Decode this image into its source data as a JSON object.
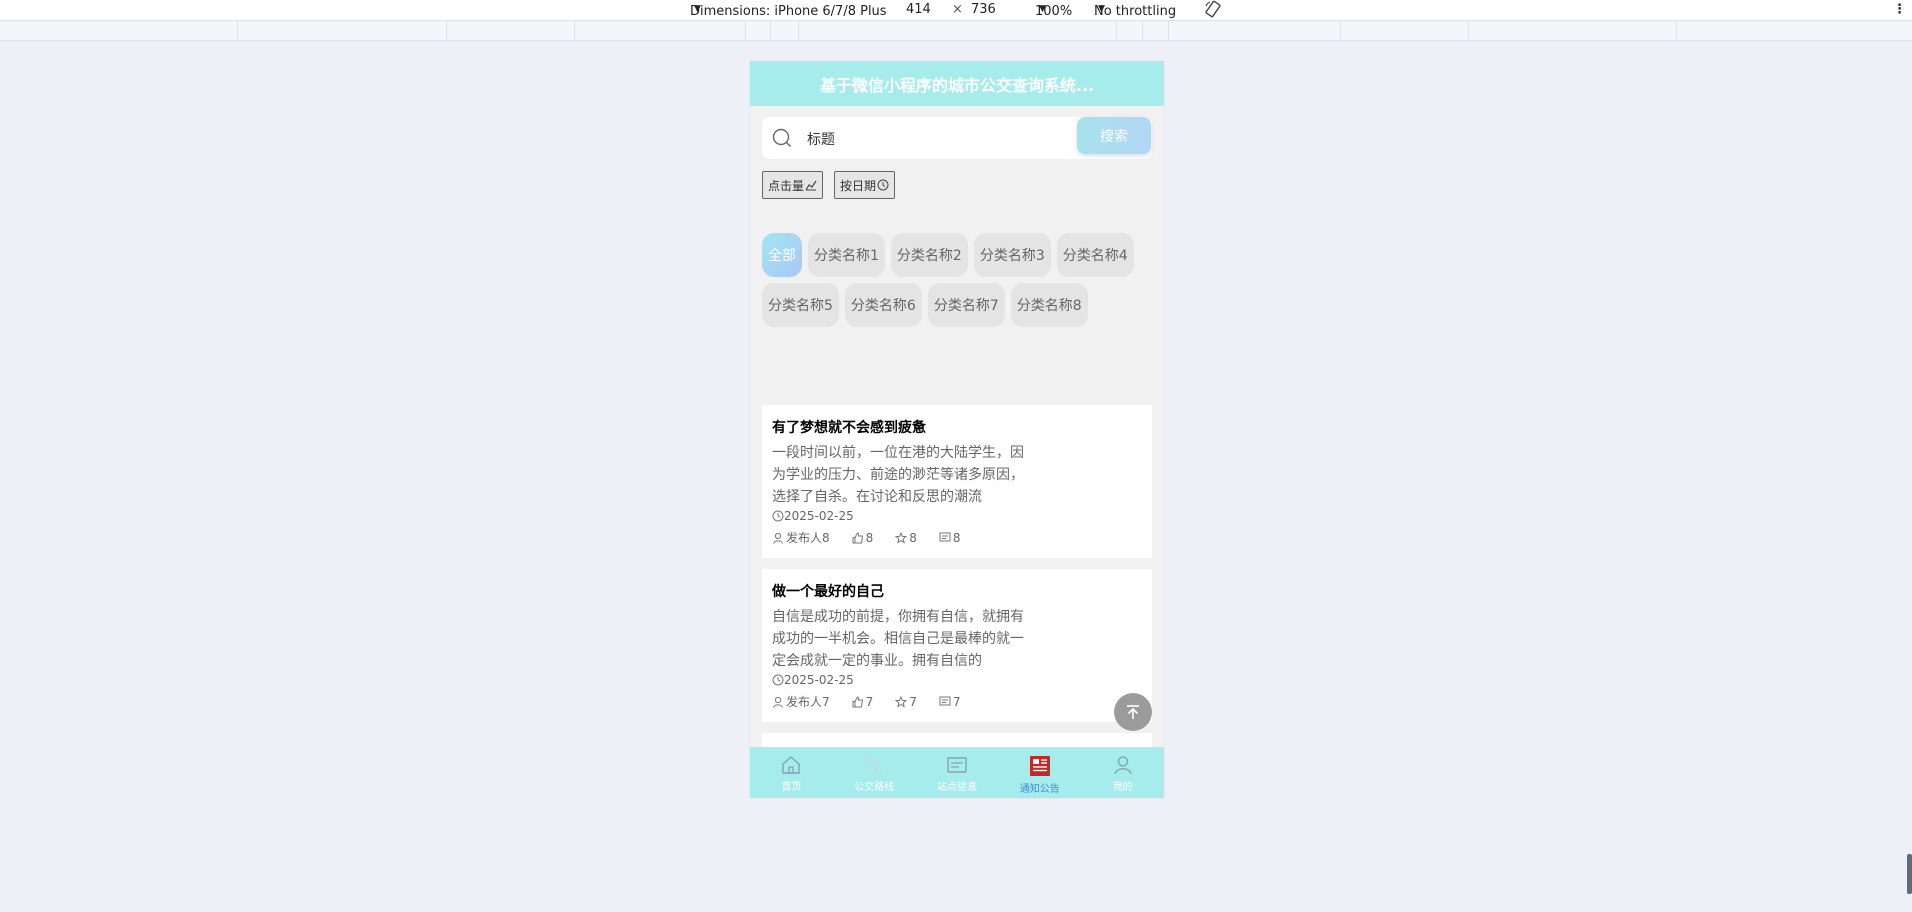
{
  "devtools": {
    "device": "Dimensions: iPhone 6/7/8 Plus",
    "width": "414",
    "times": "×",
    "height": "736",
    "zoom": "100%",
    "throttle": "No throttling",
    "more": "⋮"
  },
  "app": {
    "title": "基于微信小程序的城市公交查询系统..."
  },
  "search": {
    "value": "标题",
    "button": "搜索"
  },
  "sort": {
    "by_clicks": "点击量",
    "by_date": "按日期"
  },
  "categories": [
    "全部",
    "分类名称1",
    "分类名称2",
    "分类名称3",
    "分类名称4",
    "分类名称5",
    "分类名称6",
    "分类名称7",
    "分类名称8"
  ],
  "articles": [
    {
      "title": "有了梦想就不会感到疲惫",
      "excerpt": "一段时间以前，一位在港的大陆学生，因为学业的压力、前途的渺茫等诸多原因，选择了自杀。在讨论和反思的潮流",
      "date": "2025-02-25",
      "author": "发布人8",
      "likes": "8",
      "favorites": "8",
      "comments": "8"
    },
    {
      "title": "做一个最好的自己",
      "excerpt": "自信是成功的前提，你拥有自信，就拥有成功的一半机会。相信自己是最棒的就一定会成就一定的事业。拥有自信的",
      "date": "2025-02-25",
      "author": "发布人7",
      "likes": "7",
      "favorites": "7",
      "comments": "7"
    }
  ],
  "tabbar": {
    "items": [
      {
        "label": "首页",
        "icon": "home-icon"
      },
      {
        "label": "公交路线",
        "icon": "route-icon"
      },
      {
        "label": "站点信息",
        "icon": "station-icon"
      },
      {
        "label": "通知公告",
        "icon": "notice-icon"
      },
      {
        "label": "我的",
        "icon": "user-icon"
      }
    ],
    "active_index": 3,
    "active_color": "#3a8ee6"
  },
  "colors": {
    "header": "#a7ecec",
    "accent": "#a6e2ec"
  }
}
